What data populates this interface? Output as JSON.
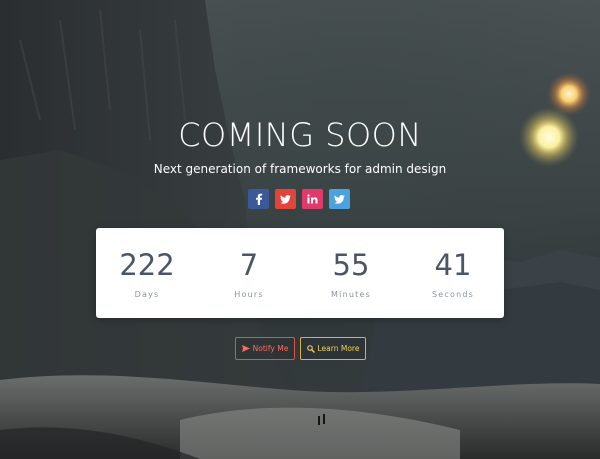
{
  "page": {
    "title": "COMING SOON",
    "subtitle": "Next generation of frameworks for admin design"
  },
  "social": [
    {
      "name": "facebook",
      "glyph": "f",
      "color": "#3b5998"
    },
    {
      "name": "twitter",
      "glyph": "twitter-bird",
      "color": "#e0443a"
    },
    {
      "name": "linkedin",
      "glyph": "in",
      "color": "#e03a6a"
    },
    {
      "name": "twitter-alt",
      "glyph": "twitter-bird",
      "color": "#4aa3df"
    }
  ],
  "countdown": {
    "days": {
      "value": "222",
      "label": "Days"
    },
    "hours": {
      "value": "7",
      "label": "Hours"
    },
    "minutes": {
      "value": "55",
      "label": "Minutes"
    },
    "seconds": {
      "value": "41",
      "label": "Seconds"
    }
  },
  "buttons": {
    "notify": {
      "label": "Notify Me",
      "icon": "send-icon"
    },
    "learn": {
      "label": "Learn More",
      "icon": "search-icon"
    }
  }
}
